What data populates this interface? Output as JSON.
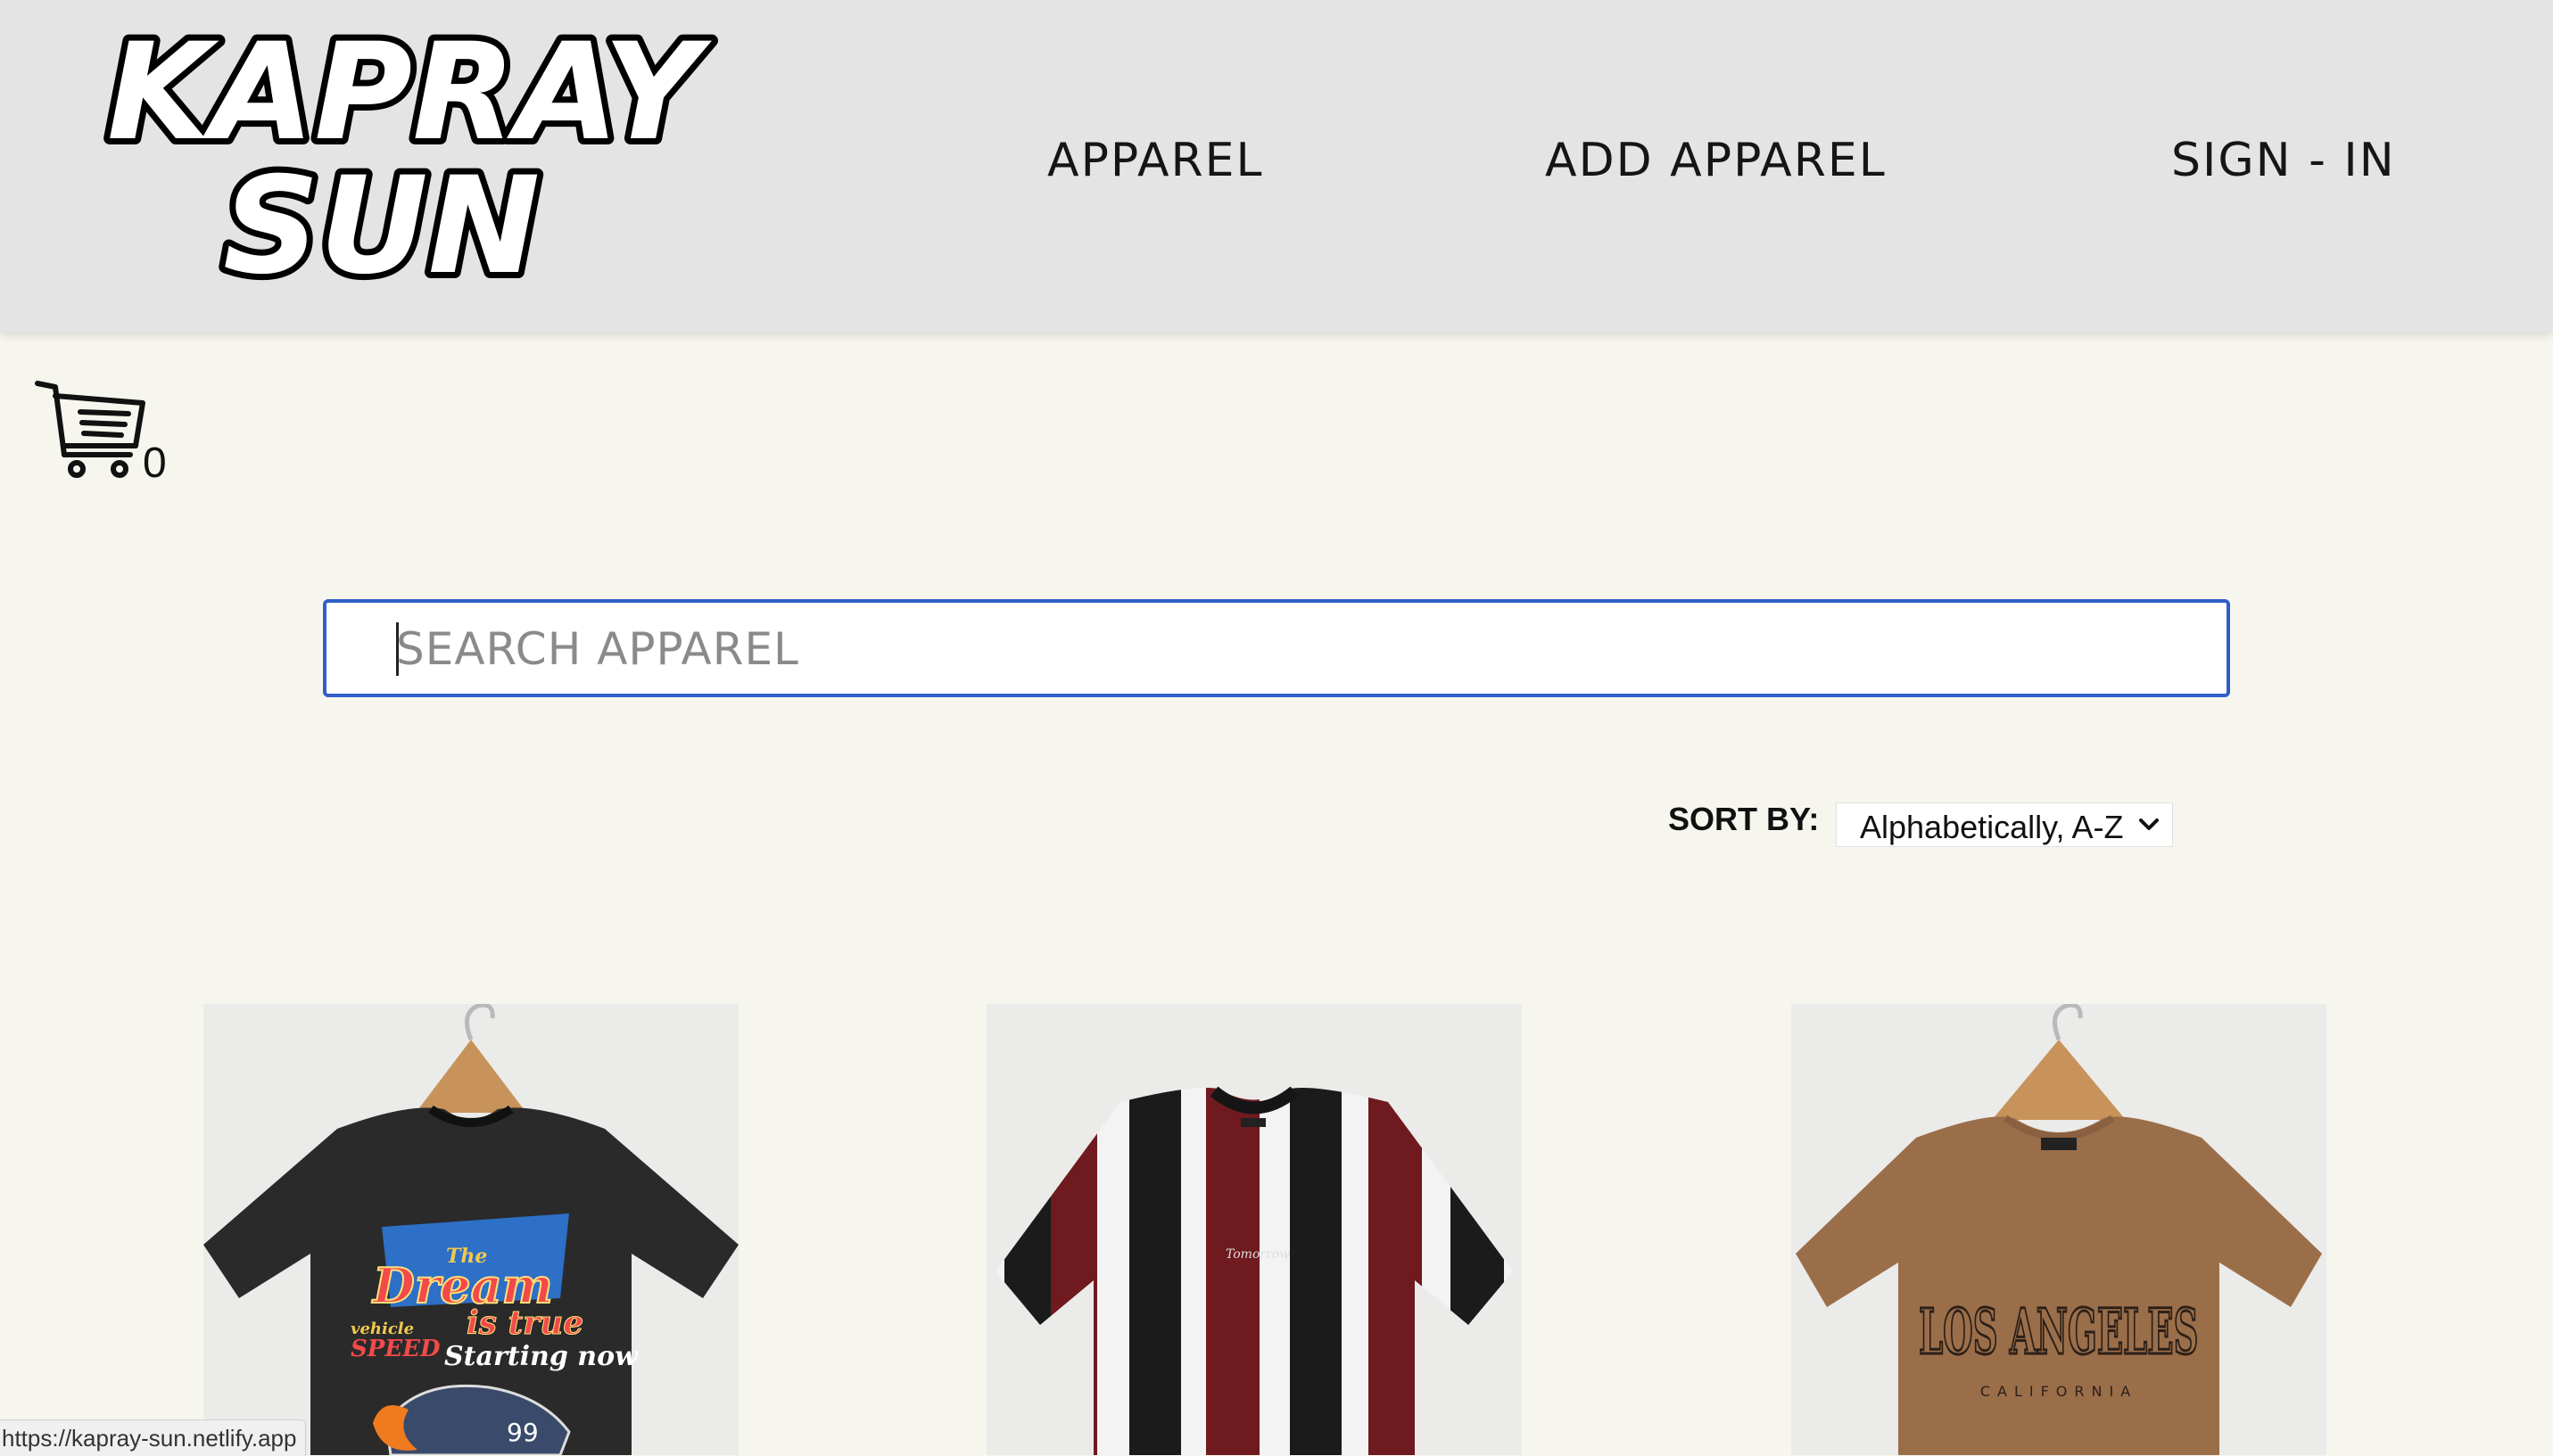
{
  "header": {
    "logo_line1": "KAPRAY",
    "logo_line2": "SUN",
    "nav": [
      {
        "label": "APPAREL"
      },
      {
        "label": "ADD APPAREL"
      },
      {
        "label": "SIGN - IN"
      }
    ]
  },
  "cart": {
    "icon": "cart-icon",
    "count": "0"
  },
  "search": {
    "placeholder": "SEARCH APPAREL",
    "value": ""
  },
  "sort": {
    "label": "SORT BY:",
    "selected": "Alphabetically, A-Z"
  },
  "products": [
    {
      "image": "black-graphic-tee",
      "print_line1": "The",
      "print_line2": "Dream",
      "print_line3": "is true",
      "print_line4": "Starting now",
      "print_side1": "vehicle",
      "print_side2": "SPEED",
      "car_number": "99"
    },
    {
      "image": "striped-tee",
      "chest_text": "Tomorrow"
    },
    {
      "image": "brown-los-angeles-tee",
      "print_line1": "LOS ANGELES",
      "print_line2": "CALIFORNIA"
    }
  ],
  "status_bar": {
    "url": "https://kapray-sun.netlify.app"
  },
  "colors": {
    "header_bg": "#e4e4e4",
    "page_bg": "#f6f6ee",
    "search_border": "#2f5fc8"
  }
}
